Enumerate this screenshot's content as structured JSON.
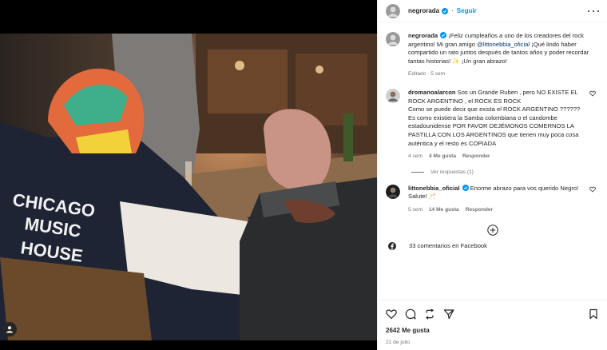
{
  "post": {
    "username": "negrorada",
    "follow_label": "Seguir",
    "caption_user": "negrorada",
    "caption_pre": "¡Feliz cumpleaños a uno de los creadores del rock argentino! Mi gran amigo ",
    "caption_mention": "@littonebbia_oficial",
    "caption_post": " ¡Qué lindo haber compartido un rato juntos después de tantos años y poder recordar tantas historias! ✨ ¡Un gran abrazo!",
    "caption_meta": "Editado · 5 sem"
  },
  "comments": [
    {
      "user": "dromanoalarcon",
      "text": "Sos un Grande Ruben , pero NO EXISTE EL ROCK ARGENTINO , el ROCK ES ROCK\nComo se puede decir que exista el ROCK ARGENTINO ??????\nEs como existiera la Samba colombiana o el candombe estadounidense POR FAVOR DEJÉMONOS COMERNOS LA PASTILLA CON LOS ARGENTINOS que tienen muy poca cosa auténtica y el resto es COPIADA",
      "time": "4 sem",
      "likes": "4 Me gusta",
      "reply": "Responder"
    },
    {
      "user": "littonebbia_oficial",
      "text": "Enorme abrazo para vos querido Negro! Salute! 🥂",
      "time": "5 sem",
      "likes": "14 Me gusta",
      "reply": "Responder"
    }
  ],
  "replies_label": "Ver respuestas (1)",
  "facebook_comments": "33 comentarios en Facebook",
  "likes_label": "2642 Me gusta",
  "date_label": "21 de julio",
  "photo_jacket_text": [
    "CHICAGO",
    "MUSIC",
    "HOUSE"
  ],
  "colors": {
    "accent": "#0095f6",
    "verified": "#0095f6",
    "link": "#00376b",
    "muted": "#737373"
  }
}
